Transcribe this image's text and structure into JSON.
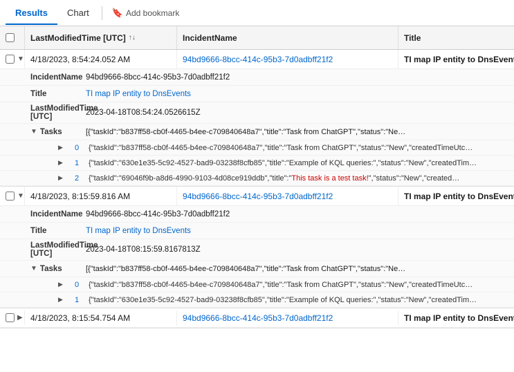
{
  "tabs": [
    {
      "id": "results",
      "label": "Results",
      "active": true
    },
    {
      "id": "chart",
      "label": "Chart",
      "active": false
    }
  ],
  "bookmark": {
    "label": "Add bookmark",
    "icon": "🔖"
  },
  "columns": [
    {
      "id": "checkbox",
      "label": ""
    },
    {
      "id": "time",
      "label": "LastModifiedTime [UTC]",
      "sortable": true
    },
    {
      "id": "incident",
      "label": "IncidentName"
    },
    {
      "id": "title",
      "label": "Title"
    }
  ],
  "rows": [
    {
      "id": "row1",
      "expanded": true,
      "checked": false,
      "time": "4/18/2023, 8:54:24.052 AM",
      "incident": "94bd9666-8bcc-414c-95b3-7d0adbff21f2",
      "title": "TI map IP entity to DnsEvents",
      "details": [
        {
          "key": "IncidentName",
          "value": "94bd9666-8bcc-414c-95b3-7d0adbff21f2",
          "blue": false
        },
        {
          "key": "Title",
          "value": "TI map IP entity to DnsEvents",
          "blue": true
        },
        {
          "key": "LastModifiedTime [UTC]",
          "value": "2023-04-18T08:54:24.0526615Z",
          "blue": false
        }
      ],
      "tasks": {
        "summary": "[{\"taskId\":\"b837ff58-cb0f-4465-b4ee-c709840648a7\",\"title\":\"Task from ChatGPT\",\"status\":\"Ne…",
        "items": [
          {
            "index": 0,
            "value": "{\"taskId\":\"b837ff58-cb0f-4465-b4ee-c709840648a7\",\"title\":\"Task from ChatGPT\",\"status\":\"New\",\"createdTimeUtc…"
          },
          {
            "index": 1,
            "value": "{\"taskId\":\"630e1e35-5c92-4527-bad9-03238f8cfb85\",\"title\":\"Example of KQL queries:\",\"status\":\"New\",\"createdTim…"
          },
          {
            "index": 2,
            "value": "{\"taskId\":\"69046f9b-a8d6-4990-9103-4d08ce919ddb\",\"title\":\"This task is a test task!\",\"status\":\"New\",\"created…",
            "hasHighlight": true,
            "highlightText": "This task is a test task!"
          }
        ]
      }
    },
    {
      "id": "row2",
      "expanded": true,
      "checked": false,
      "time": "4/18/2023, 8:15:59.816 AM",
      "incident": "94bd9666-8bcc-414c-95b3-7d0adbff21f2",
      "title": "TI map IP entity to DnsEvents",
      "details": [
        {
          "key": "IncidentName",
          "value": "94bd9666-8bcc-414c-95b3-7d0adbff21f2",
          "blue": false
        },
        {
          "key": "Title",
          "value": "TI map IP entity to DnsEvents",
          "blue": true
        },
        {
          "key": "LastModifiedTime [UTC]",
          "value": "2023-04-18T08:15:59.8167813Z",
          "blue": false
        }
      ],
      "tasks": {
        "summary": "[{\"taskId\":\"b837ff58-cb0f-4465-b4ee-c709840648a7\",\"title\":\"Task from ChatGPT\",\"status\":\"Ne…",
        "items": [
          {
            "index": 0,
            "value": "{\"taskId\":\"b837ff58-cb0f-4465-b4ee-c709840648a7\",\"title\":\"Task from ChatGPT\",\"status\":\"New\",\"createdTimeUtc…"
          },
          {
            "index": 1,
            "value": "{\"taskId\":\"630e1e35-5c92-4527-bad9-03238f8cfb85\",\"title\":\"Example of KQL queries:\",\"status\":\"New\",\"createdTim…"
          }
        ]
      }
    },
    {
      "id": "row3",
      "expanded": false,
      "checked": false,
      "time": "4/18/2023, 8:15:54.754 AM",
      "incident": "94bd9666-8bcc-414c-95b3-7d0adbff21f2",
      "title": "TI map IP entity to DnsEvents"
    }
  ]
}
